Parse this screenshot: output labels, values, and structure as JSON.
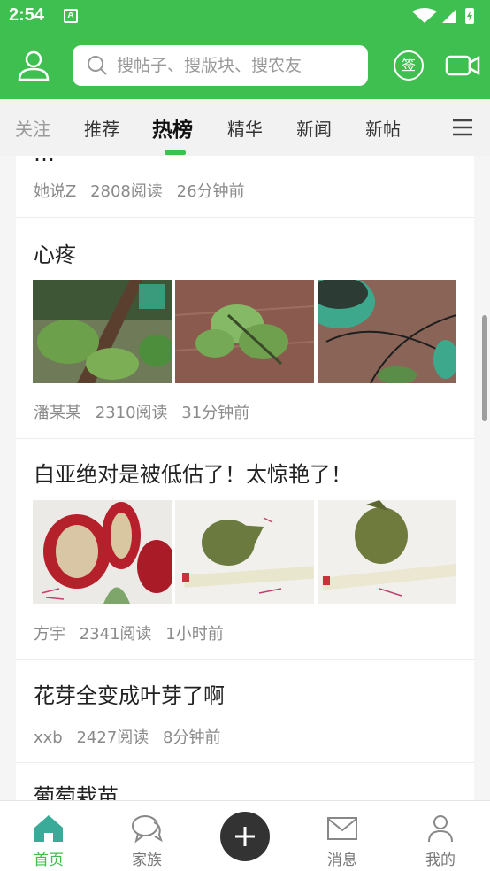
{
  "status_bar": {
    "time": "2:54",
    "notification_badge": "A"
  },
  "header": {
    "search_placeholder": "搜帖子、搜版块、搜农友",
    "checkin_label": "签",
    "accent_color": "#3fbf4f"
  },
  "tabs": [
    {
      "label": "关注"
    },
    {
      "label": "推荐"
    },
    {
      "label": "热榜",
      "selected": true
    },
    {
      "label": "精华"
    },
    {
      "label": "新闻"
    },
    {
      "label": "新帖"
    }
  ],
  "posts": [
    {
      "title": "…",
      "author": "她说Z",
      "reads": "2808阅读",
      "time": "26分钟前",
      "images": []
    },
    {
      "title": "心疼",
      "author": "潘某某",
      "reads": "2310阅读",
      "time": "31分钟前",
      "images": [
        "fig-branch-photo",
        "fig-leaves-photo",
        "potted-plant-photo"
      ]
    },
    {
      "title": "白亚绝对是被低估了！太惊艳了！",
      "author": "方宇",
      "reads": "2341阅读",
      "time": "1小时前",
      "images": [
        "cut-fig-photo",
        "fig-with-tape-photo",
        "fig-with-tape-photo-2"
      ]
    },
    {
      "title": "花芽全变成叶芽了啊",
      "author": "xxb",
      "reads": "2427阅读",
      "time": "8分钟前",
      "images": []
    },
    {
      "title": "葡萄栽苗",
      "author": "",
      "reads": "",
      "time": "",
      "images": []
    }
  ],
  "bottom_nav": [
    {
      "label": "首页",
      "icon": "home-icon",
      "active": true
    },
    {
      "label": "家族",
      "icon": "chat-icon"
    },
    {
      "label": "",
      "icon": "plus-icon"
    },
    {
      "label": "消息",
      "icon": "mail-icon"
    },
    {
      "label": "我的",
      "icon": "user-icon"
    }
  ]
}
